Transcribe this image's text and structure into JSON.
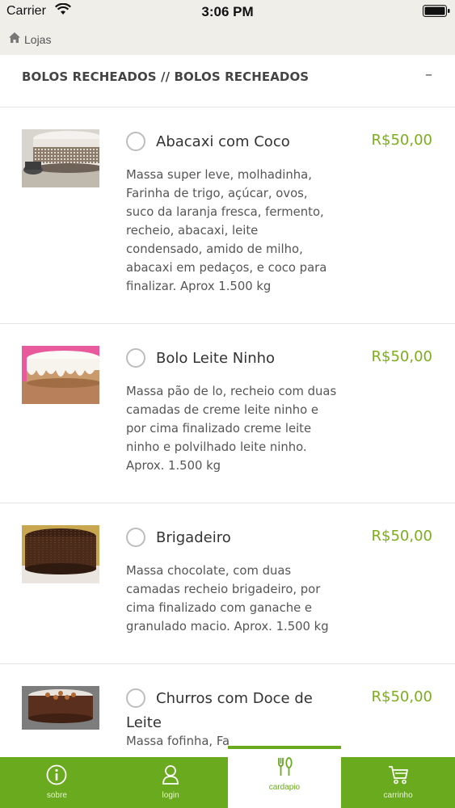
{
  "status_bar": {
    "carrier": "Carrier",
    "time": "3:06 PM"
  },
  "nav": {
    "back_label": "Lojas"
  },
  "section": {
    "title": "BOLOS RECHEADOS // BOLOS RECHEADOS",
    "collapse_symbol": "–"
  },
  "products": [
    {
      "name": "Abacaxi com Coco",
      "price": "R$50,00",
      "description": "Massa super leve, molhadinha, Farinha de trigo, açúcar, ovos, suco da laranja fresca, fermento, recheio, abacaxi, leite condensado, amido de milho, abacaxi em pedaços, e coco para finalizar. Aprox 1.500 kg"
    },
    {
      "name": "Bolo Leite Ninho",
      "price": "R$50,00",
      "description": "Massa pão de lo, recheio com duas camadas de creme leite ninho e por cima finalizado creme leite ninho e polvilhado leite ninho. Aprox. 1.500 kg"
    },
    {
      "name": "Brigadeiro",
      "price": "R$50,00",
      "description": "Massa chocolate, com duas camadas recheio brigadeiro, por cima finalizado com ganache e granulado macio. Aprox. 1.500 kg"
    },
    {
      "name": "Churros com Doce de Leite",
      "price": "R$50,00",
      "description": "Massa fofinha, Fa"
    }
  ],
  "tabs": [
    {
      "label": "sobre",
      "icon": "info-icon"
    },
    {
      "label": "login",
      "icon": "user-icon"
    },
    {
      "label": "cardapio",
      "icon": "fork-knife-icon",
      "active": true
    },
    {
      "label": "carrinho",
      "icon": "cart-icon"
    }
  ],
  "colors": {
    "accent": "#6aaa1e",
    "price": "#7cad1c",
    "bar_bg": "#efeee9"
  }
}
